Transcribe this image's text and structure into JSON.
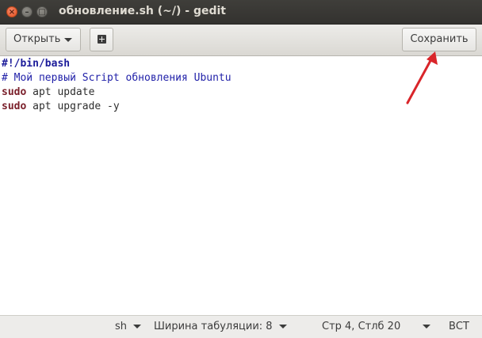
{
  "window": {
    "title": "обновление.sh (~/) - gedit",
    "close_glyph": "×",
    "min_glyph": "–",
    "max_glyph": "□"
  },
  "header": {
    "open_label": "Открыть",
    "save_label": "Сохранить",
    "new_tab_icon": "new-tab-icon"
  },
  "editor": {
    "lines": [
      {
        "kw": "",
        "text": "#!/bin/bash"
      },
      {
        "kw": "",
        "text": "# Мой первый Script обновления Ubuntu"
      },
      {
        "kw": "sudo",
        "text": " apt update"
      },
      {
        "kw": "sudo",
        "text": " apt upgrade -y"
      }
    ]
  },
  "status": {
    "language": "sh",
    "tab_width": "Ширина табуляции: 8",
    "cursor": "Стр 4, Стлб 20",
    "insert_mode": "ВСТ"
  },
  "colors": {
    "annotation_arrow": "#d9252a",
    "keyword": "#7a1f2a",
    "comment": "#1f1fa8"
  }
}
